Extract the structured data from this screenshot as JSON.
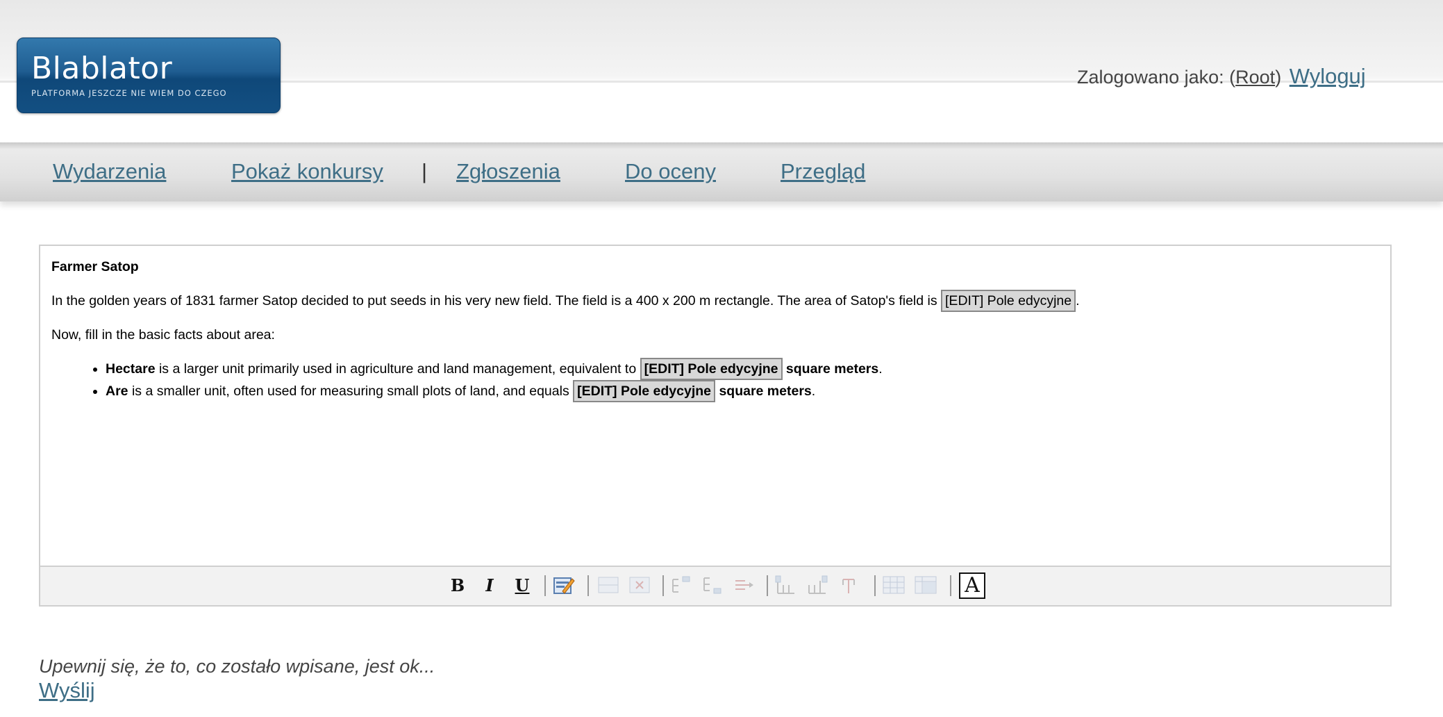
{
  "header": {
    "logo_title": "Blablator",
    "logo_subtitle": "PLATFORMA JESZCZE NIE WIEM DO CZEGO",
    "login_prefix": "Zalogowano jako: (",
    "user_name": "Root",
    "login_suffix": ")",
    "logout_label": "Wyloguj"
  },
  "nav": {
    "items": [
      "Wydarzenia",
      "Pokaż konkursy",
      "Zgłoszenia",
      "Do oceny",
      "Przegląd"
    ],
    "separator": "|"
  },
  "editor": {
    "title": "Farmer Satop",
    "paragraph1_text": "In the golden years of 1831 farmer Satop decided to put seeds in his very new field. The field is a 400 x 200 m rectangle. The area of Satop's field is ",
    "paragraph1_end": ".",
    "field_label": "[EDIT] Pole edycyjne",
    "paragraph2": "Now, fill in the basic facts about area:",
    "bullets": [
      {
        "term": "Hectare",
        "text": " is a larger unit primarily used in agriculture and land management, equivalent to ",
        "unit": "square meters",
        "end": "."
      },
      {
        "term": "Are",
        "text": " is a smaller unit, often used for measuring small plots of land, and equals ",
        "unit": "square meters",
        "end": "."
      }
    ],
    "toolbar": {
      "bold": "B",
      "italic": "I",
      "underline": "U",
      "icons": [
        "edit-field-icon",
        "row-icon",
        "delete-row-icon",
        "insert-before-icon",
        "insert-after-icon",
        "move-icon",
        "column-before-icon",
        "column-after-icon",
        "delete-column-icon",
        "table-icon",
        "table-props-icon",
        "font-icon"
      ],
      "font_glyph": "A"
    }
  },
  "footer": {
    "note": "Upewnij się, że to, co zostało wpisane, jest ok...",
    "send_label": "Wyślij"
  },
  "colors": {
    "link": "#3e6e86",
    "logo_blue": "#1f5d91"
  }
}
